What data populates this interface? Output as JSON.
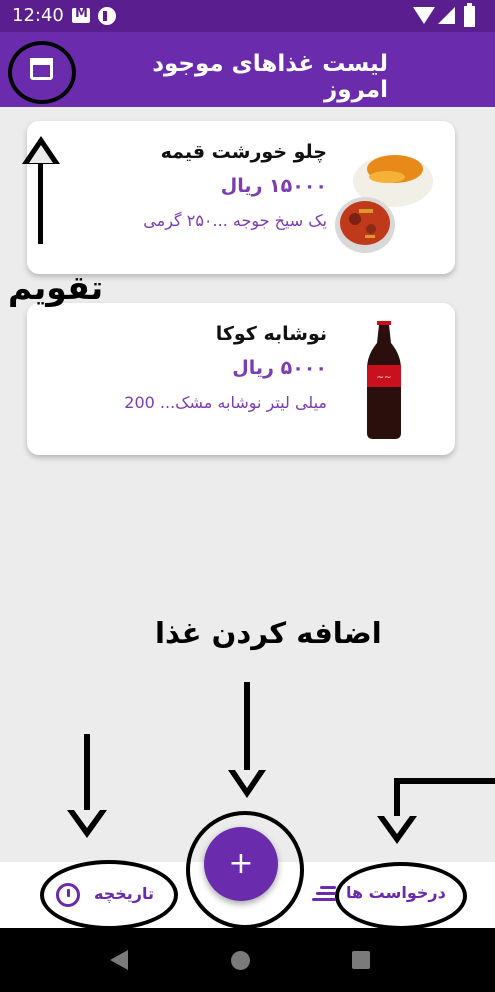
{
  "status_bar": {
    "time": "12:40"
  },
  "app_bar": {
    "title": "لیست غذاهای موجود امروز",
    "calendar_icon": "calendar-icon"
  },
  "food_items": [
    {
      "title": "چلو خورشت قیمه",
      "price": "۱۵۰۰۰ ریال",
      "description": "یک سیخ جوجه ...۲۵۰ گرمی",
      "image": "rice-stew-dish"
    },
    {
      "title": "نوشابه کوکا",
      "price": "۵۰۰۰ ریال",
      "description": "میلی لیتر نوشابه مشک... 200",
      "image": "cola-bottle"
    }
  ],
  "annotations": {
    "calendar_label": "تقویم",
    "add_food_label": "اضافه کردن غذا"
  },
  "bottom_bar": {
    "history_label": "تاریخچه",
    "requests_label": "درخواست ها",
    "fab_label": "+"
  },
  "colors": {
    "primary": "#6a2bad",
    "status_bar": "#5a1e8f",
    "accent_text": "#7b3db3",
    "background": "#ececec"
  }
}
